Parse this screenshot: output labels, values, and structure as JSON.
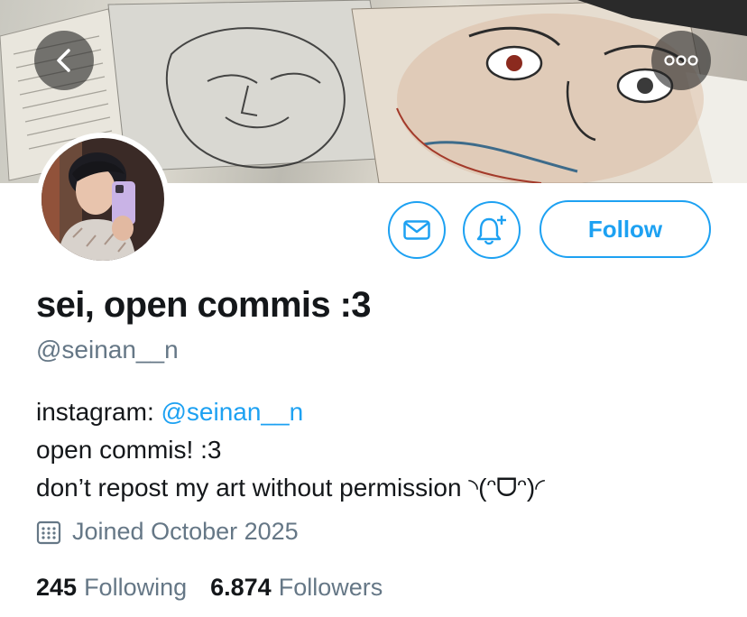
{
  "profile": {
    "display_name": "sei, open commis :3",
    "handle": "@seinan__n",
    "follow_label": "Follow"
  },
  "bio": {
    "line1_prefix": "instagram: ",
    "line1_mention": "@seinan__n",
    "line2": "open commis! :3",
    "line3": "don’t repost my art without permission ◝(ᵔᗜᵔ)◜"
  },
  "meta": {
    "joined": "Joined October 2025"
  },
  "stats": {
    "following_count": "245",
    "following_label": "Following",
    "followers_count": "6.874",
    "followers_label": "Followers"
  },
  "icons": {
    "back": "chevron-left-icon",
    "more": "more-horizontal-icon",
    "message": "envelope-icon",
    "notify": "bell-plus-icon",
    "calendar": "calendar-icon"
  },
  "colors": {
    "accent": "#1da1f2",
    "secondary_text": "#657786",
    "primary_text": "#14171a"
  }
}
